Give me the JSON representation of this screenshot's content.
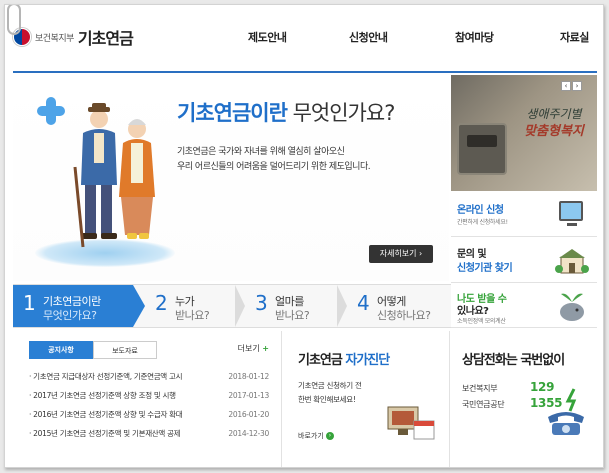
{
  "header": {
    "ministry": "보건복지부",
    "site_title": "기초연금",
    "nav": [
      "제도안내",
      "신청안내",
      "참여마당",
      "자료실"
    ]
  },
  "hero": {
    "title_highlight": "기초연금이란",
    "title_rest": " 무엇인가요?",
    "desc_line1": "기초연금은 국가와 자녀를 위해 열심히 살아오신",
    "desc_line2": "우리 어르신들의 어려움을 덜어드리기 위한 제도입니다.",
    "detail_button": "자세히보기 ›"
  },
  "banner": {
    "line1": "생애주기별",
    "line2": "맞춤형복지",
    "prev": "‹",
    "next": "›"
  },
  "side": {
    "online_title": "온라인 신청",
    "online_sub": "간편하게 신청하세요!",
    "inquiry_line1": "문의 및",
    "inquiry_line2": "신청기관 찾기",
    "calc_line1": "나도 받을 수",
    "calc_line2": "있나요?",
    "calc_sub": "소득인정액 모의계산"
  },
  "steps": [
    {
      "num": "1",
      "t1": "기초연금이란",
      "t2": "무엇인가요?"
    },
    {
      "num": "2",
      "t1": "누가",
      "t2": "받나요?"
    },
    {
      "num": "3",
      "t1": "얼마를",
      "t2": "받나요?"
    },
    {
      "num": "4",
      "t1": "어떻게",
      "t2": "신청하나요?"
    }
  ],
  "news": {
    "tab_notice": "공지사항",
    "tab_press": "보도자료",
    "more": "더보기",
    "items": [
      {
        "title": "· 기초연금 지급대상자 선정기준액, 기준연금액 고시",
        "date": "2018-01-12"
      },
      {
        "title": "· 2017년 기초연금 선정기준액 상향 조정 및 시행",
        "date": "2017-01-13"
      },
      {
        "title": "· 2016년 기초연금 선정기준액 상향 및 수급자 확대",
        "date": "2016-01-20"
      },
      {
        "title": "· 2015년 기초연금 선정기준액 및 기본재산액 공제",
        "date": "2014-12-30"
      }
    ]
  },
  "self_check": {
    "title_plain": "기초연금 ",
    "title_blue": "자가진단",
    "line1": "기초연금 신청하기 전",
    "line2": "한번 확인해보세요!",
    "link": "바로가기"
  },
  "hotline": {
    "title_plain": "상담전화는 ",
    "title_bold": "국번없이",
    "org1": "보건복지부",
    "num1": "129",
    "org2": "국민연금공단",
    "num2": "1355"
  }
}
